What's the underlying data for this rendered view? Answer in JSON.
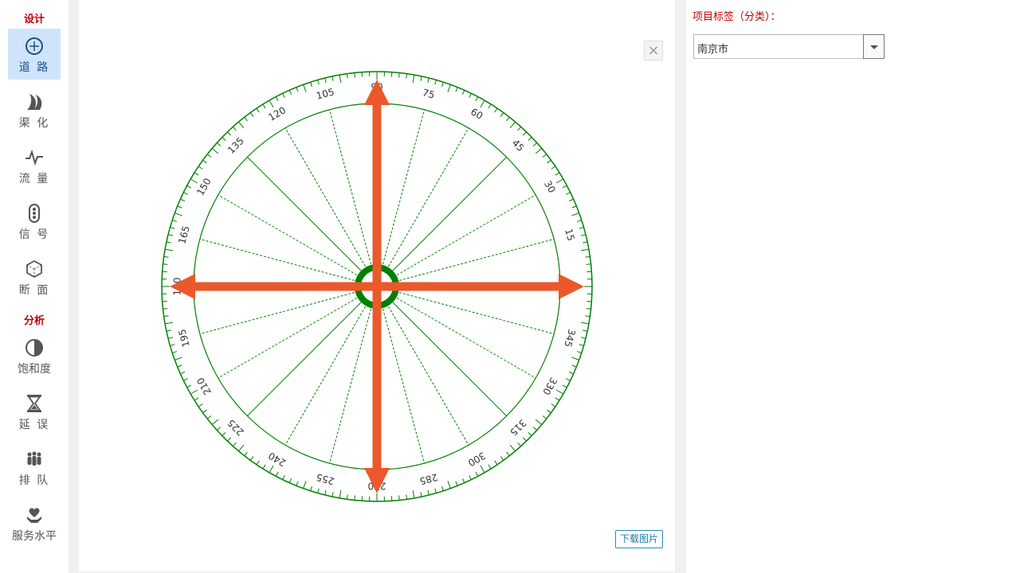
{
  "sidebar": {
    "sections": {
      "design": "设计",
      "analysis": "分析"
    },
    "items": [
      {
        "key": "road",
        "label": "道 路",
        "icon": "crosshair-icon",
        "active": true
      },
      {
        "key": "channel",
        "label": "渠 化",
        "icon": "curve-icon"
      },
      {
        "key": "flow",
        "label": "流 量",
        "icon": "pulse-icon"
      },
      {
        "key": "signal",
        "label": "信 号",
        "icon": "traffic-light-icon"
      },
      {
        "key": "section",
        "label": "断 面",
        "icon": "cube-icon"
      },
      {
        "key": "saturation",
        "label": "饱和度",
        "icon": "half-circle-icon"
      },
      {
        "key": "delay",
        "label": "延 误",
        "icon": "hourglass-icon"
      },
      {
        "key": "queue",
        "label": "排 队",
        "icon": "people-icon"
      },
      {
        "key": "service",
        "label": "服务水平",
        "icon": "heart-hand-icon"
      }
    ]
  },
  "main": {
    "close_label": "×",
    "download_label": "下载图片",
    "compass": {
      "tick_labels": [
        "0",
        "15",
        "30",
        "45",
        "60",
        "75",
        "90",
        "105",
        "120",
        "135",
        "150",
        "165",
        "180",
        "195",
        "210",
        "225",
        "240",
        "255",
        "270",
        "285",
        "300",
        "315",
        "330",
        "345"
      ],
      "hidden_labels": [
        "0",
        "90",
        "180",
        "270"
      ],
      "line_color": "#008000",
      "arrow_color": "#ea582c",
      "arrow_directions": [
        "90",
        "180",
        "270",
        "0"
      ]
    }
  },
  "right": {
    "tag_label": "项目标签（分类）：",
    "city_value": "南京市"
  },
  "colors": {
    "accent_red": "#c00000",
    "active_bg": "#cfe4fb",
    "button_blue": "#1f7aa0"
  }
}
